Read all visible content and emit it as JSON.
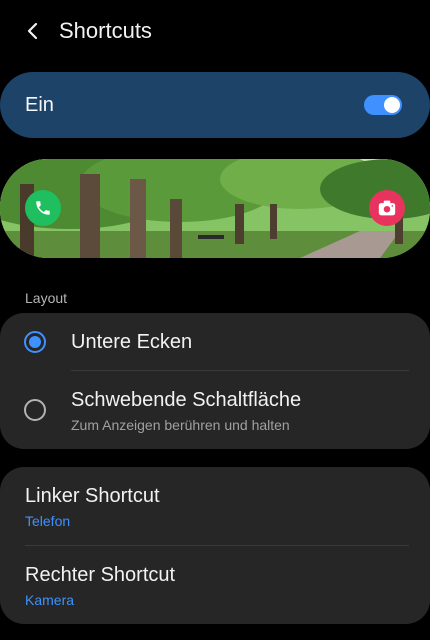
{
  "header": {
    "title": "Shortcuts"
  },
  "master": {
    "label": "Ein",
    "enabled": true
  },
  "preview": {
    "left_icon": "phone-icon",
    "right_icon": "camera-icon",
    "left_color": "#1fbf5f",
    "right_color": "#e8335e"
  },
  "layout": {
    "label": "Layout",
    "options": [
      {
        "label": "Untere Ecken",
        "sublabel": "",
        "selected": true
      },
      {
        "label": "Schwebende Schaltfläche",
        "sublabel": "Zum Anzeigen berühren und halten",
        "selected": false
      }
    ]
  },
  "shortcuts": {
    "left": {
      "title": "Linker Shortcut",
      "value": "Telefon"
    },
    "right": {
      "title": "Rechter Shortcut",
      "value": "Kamera"
    }
  },
  "colors": {
    "accent": "#3e91ff",
    "master_bg": "#1d4369",
    "card_bg": "#262626"
  }
}
